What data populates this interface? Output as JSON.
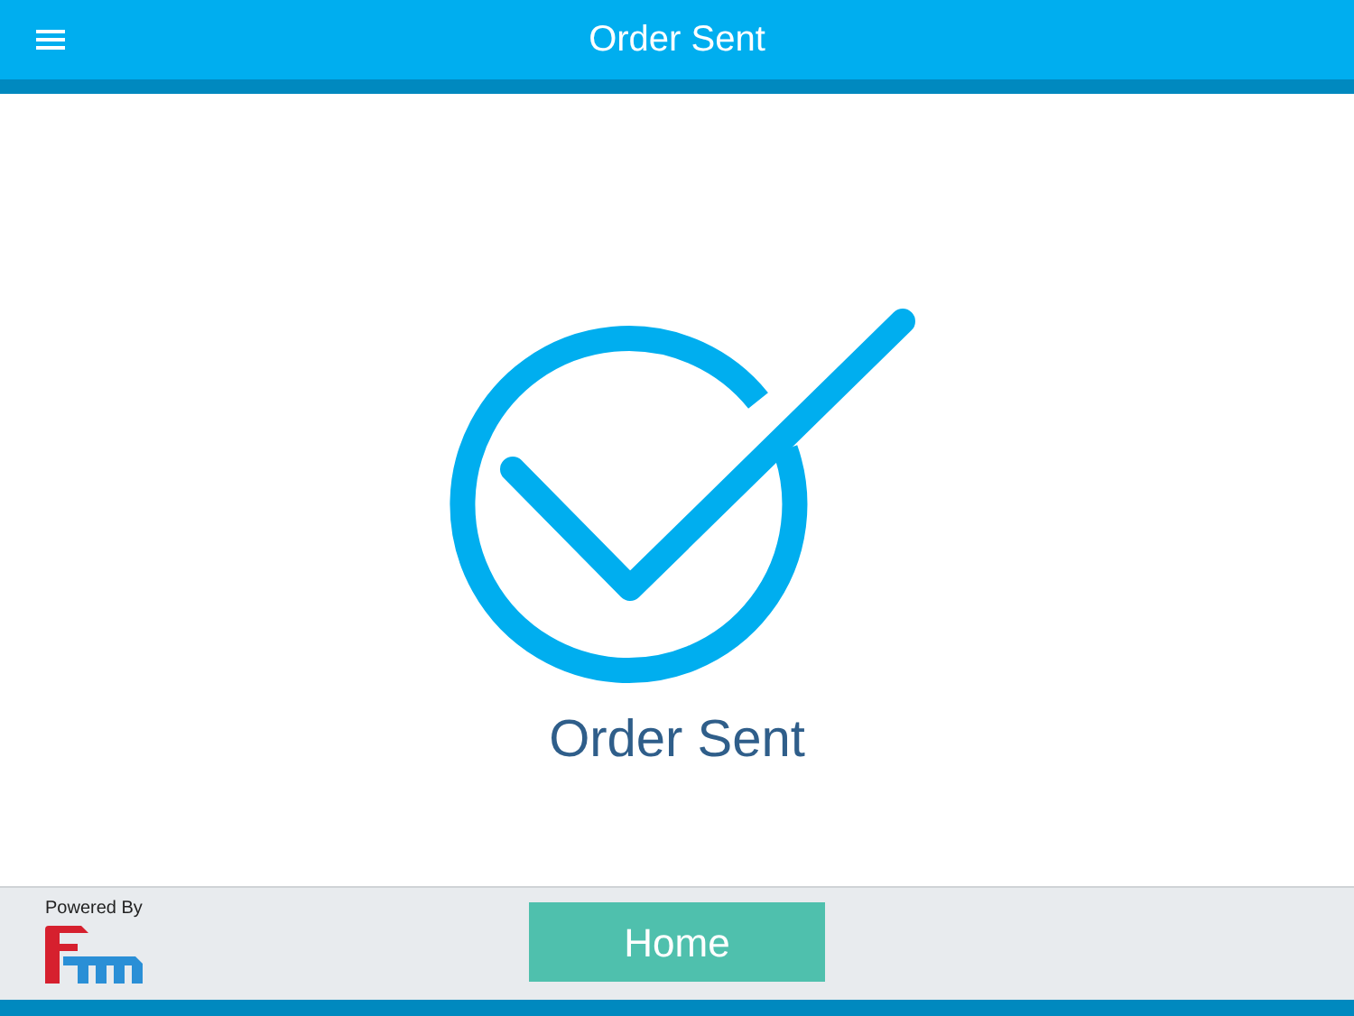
{
  "header": {
    "title": "Order Sent"
  },
  "message": "Order Sent",
  "footer": {
    "powered_by": "Powered By",
    "button": "Home"
  }
}
